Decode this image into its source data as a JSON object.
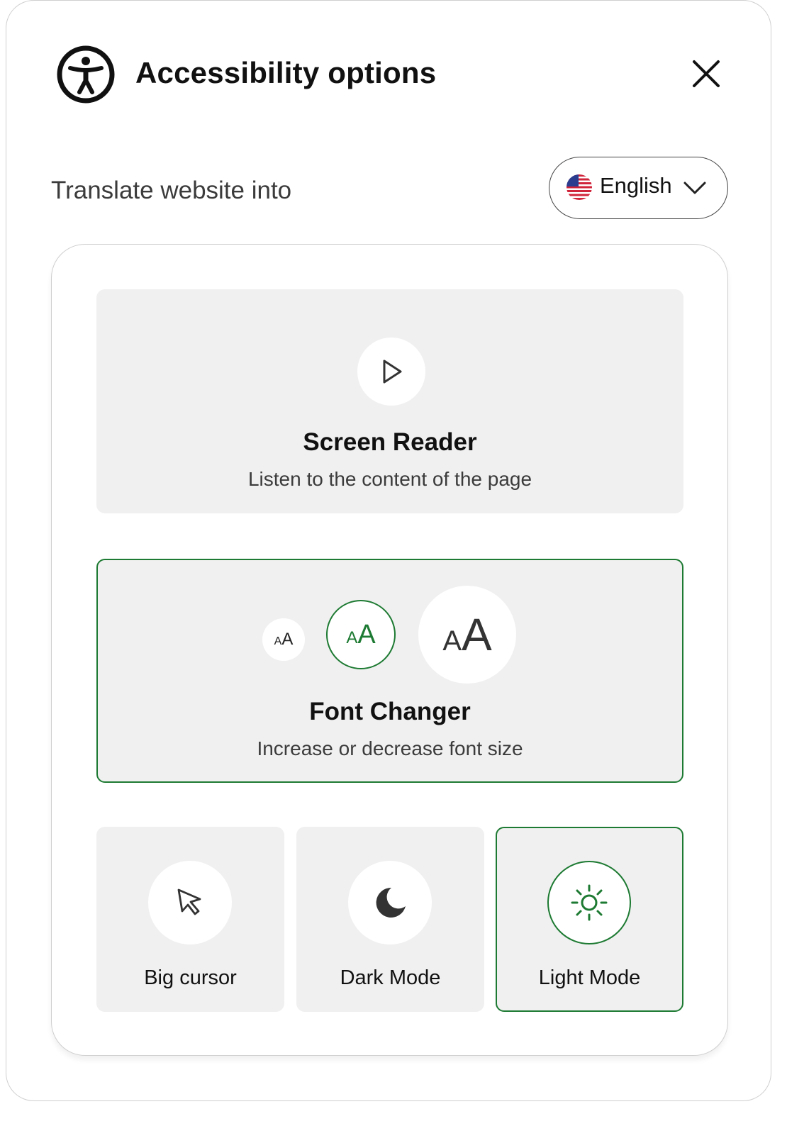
{
  "header": {
    "title": "Accessibility options",
    "icon": "accessibility-icon",
    "close_icon": "close-icon"
  },
  "translate": {
    "label": "Translate website into",
    "selected_language": "English",
    "flag_icon": "us-flag-icon",
    "chevron_icon": "chevron-down-icon"
  },
  "screen_reader": {
    "title": "Screen Reader",
    "subtitle": "Listen to the content of the page",
    "icon": "play-icon"
  },
  "font_changer": {
    "title": "Font Changer",
    "subtitle": "Increase or decrease font size",
    "sizes": [
      {
        "label_small": "A",
        "label_large": "A",
        "selected": false
      },
      {
        "label_small": "A",
        "label_large": "A",
        "selected": true
      },
      {
        "label_small": "A",
        "label_large": "A",
        "selected": false
      }
    ]
  },
  "modes": {
    "big_cursor": {
      "label": "Big cursor",
      "icon": "cursor-arrow-icon",
      "active": false
    },
    "dark_mode": {
      "label": "Dark Mode",
      "icon": "moon-icon",
      "active": false
    },
    "light_mode": {
      "label": "Light Mode",
      "icon": "sun-icon",
      "active": true
    }
  },
  "colors": {
    "accent_green": "#1d7a32",
    "tile_bg": "#f0f0f0",
    "text_dark": "#111111",
    "text_muted": "#3b3b3b"
  }
}
